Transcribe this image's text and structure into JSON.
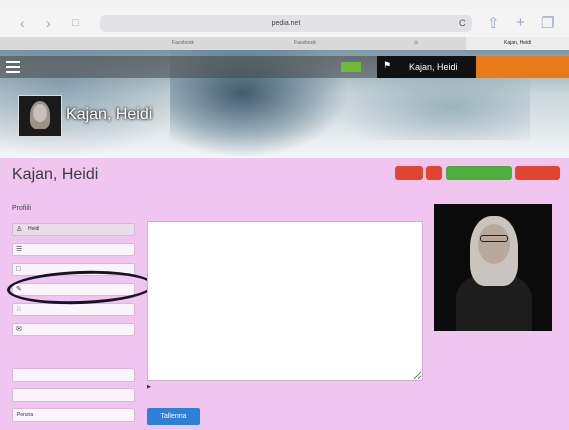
{
  "status_bar": {
    "carrier": "",
    "time": "",
    "battery": ""
  },
  "browser": {
    "address": "pedia.net",
    "reload_icon": "C",
    "tabs": [
      {
        "label": ""
      },
      {
        "label": "Facebook"
      },
      {
        "label": "Facebook"
      },
      {
        "label": "Kajan, Heidi"
      }
    ]
  },
  "site_nav": {
    "title": "",
    "center_text": "",
    "user_name": "Kajan, Heidi",
    "logout_label": ""
  },
  "banner": {
    "breadcrumb": "",
    "name": "Kajan, Heidi"
  },
  "profile": {
    "name": "Kajan, Heidi",
    "small_links": [
      "",
      "",
      ""
    ],
    "actions": {
      "first": "",
      "second": "",
      "third": "",
      "fourth": ""
    }
  },
  "sidebar": {
    "heading": "Profiili",
    "items": [
      {
        "label": "Heidi",
        "icon": "person-icon"
      },
      {
        "label": "",
        "icon": "list-icon"
      },
      {
        "label": "",
        "icon": "folder-icon"
      },
      {
        "label": "",
        "icon": "pencil-icon"
      },
      {
        "label": "",
        "icon": "people-icon"
      },
      {
        "label": "",
        "icon": "mail-icon"
      }
    ],
    "links_heading": "",
    "links": [
      {
        "label": ""
      },
      {
        "label": ""
      },
      {
        "label": "Peruna"
      }
    ]
  },
  "main": {
    "note_label": "",
    "note_value": "",
    "privacy_text": "",
    "save_label": "Tallenna"
  }
}
